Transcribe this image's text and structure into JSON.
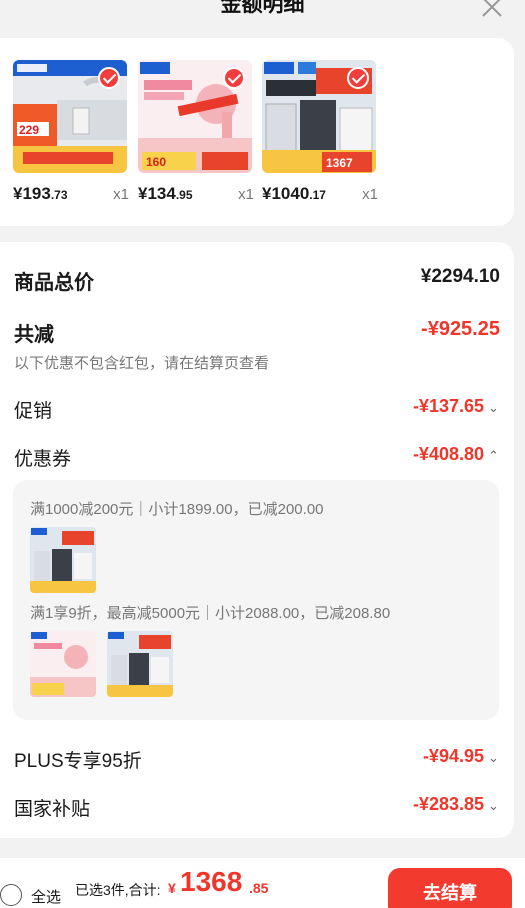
{
  "header": {
    "title": "金额明细"
  },
  "products": [
    {
      "price_int": "¥193",
      "price_dec": ".73",
      "qty": "x1"
    },
    {
      "price_int": "¥134",
      "price_dec": ".95",
      "qty": "x1"
    },
    {
      "price_int": "¥1040",
      "price_dec": ".17",
      "qty": "x1"
    }
  ],
  "detail": {
    "total_label": "商品总价",
    "total_value": "¥2294.10",
    "reduce_label": "共减",
    "reduce_value": "-¥925.25",
    "reduce_note": "以下优惠不包含红包，请在结算页查看",
    "promo_label": "促销",
    "promo_value": "-¥137.65",
    "coupon_label": "优惠券",
    "coupon_value": "-¥408.80",
    "coupon_lines": [
      "满1000减200元｜小计1899.00，已减200.00",
      "满1享9折，最高减5000元｜小计2088.00，已减208.80"
    ],
    "plus_label": "PLUS专享95折",
    "plus_value": "-¥94.95",
    "subsidy_label": "国家补贴",
    "subsidy_value": "-¥283.85"
  },
  "bottom": {
    "select_all": "全选",
    "summary": "已选3件,合计:",
    "currency": "¥",
    "total_int": "1368",
    "total_dec": ".85",
    "checkout": "去结算"
  },
  "colors": {
    "accent": "#f0362a",
    "check": "#f33d3d"
  }
}
